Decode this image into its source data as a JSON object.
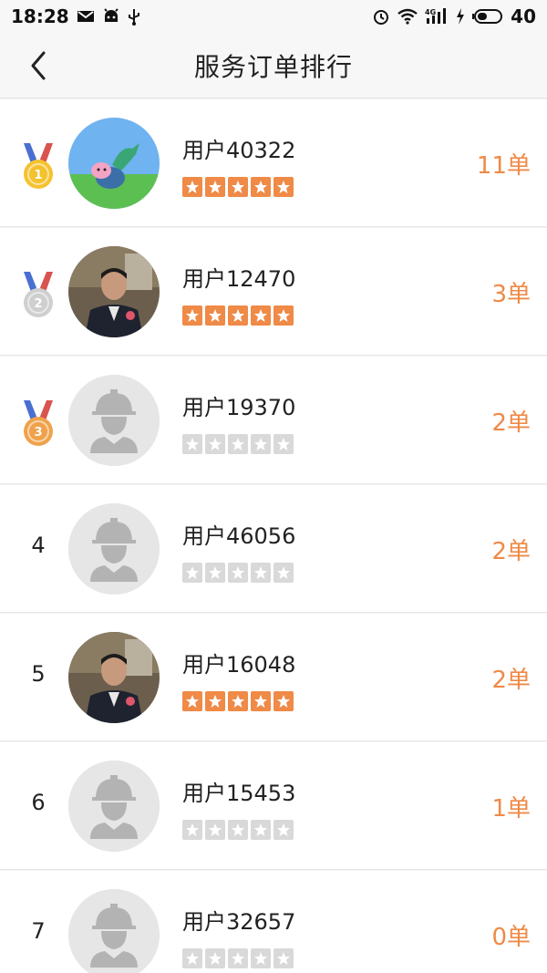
{
  "status_bar": {
    "time": "18:28",
    "battery": "40",
    "network": "4G"
  },
  "header": {
    "title": "服务订单排行"
  },
  "colors": {
    "accent": "#ef8a47",
    "star_off": "#d9d9d9",
    "gold": "#f5c22f",
    "silver": "#cfcfcf",
    "bronze": "#efa24b",
    "ribbon_red": "#d9534f",
    "ribbon_blue": "#4a6fd1"
  },
  "rankings": [
    {
      "rank": "1",
      "medal": "gold",
      "name": "用户40322",
      "rating": 5,
      "orders": "11单",
      "avatar": "cartoon-pig-avatar"
    },
    {
      "rank": "2",
      "medal": "silver",
      "name": "用户12470",
      "rating": 5,
      "orders": "3单",
      "avatar": "man-in-suit-photo"
    },
    {
      "rank": "3",
      "medal": "bronze",
      "name": "用户19370",
      "rating": 0,
      "orders": "2单",
      "avatar": "worker-placeholder"
    },
    {
      "rank": "4",
      "medal": "",
      "name": "用户46056",
      "rating": 0,
      "orders": "2单",
      "avatar": "worker-placeholder"
    },
    {
      "rank": "5",
      "medal": "",
      "name": "用户16048",
      "rating": 5,
      "orders": "2单",
      "avatar": "man-in-suit-photo"
    },
    {
      "rank": "6",
      "medal": "",
      "name": "用户15453",
      "rating": 0,
      "orders": "1单",
      "avatar": "worker-placeholder"
    },
    {
      "rank": "7",
      "medal": "",
      "name": "用户32657",
      "rating": 0,
      "orders": "0单",
      "avatar": "worker-placeholder"
    }
  ]
}
